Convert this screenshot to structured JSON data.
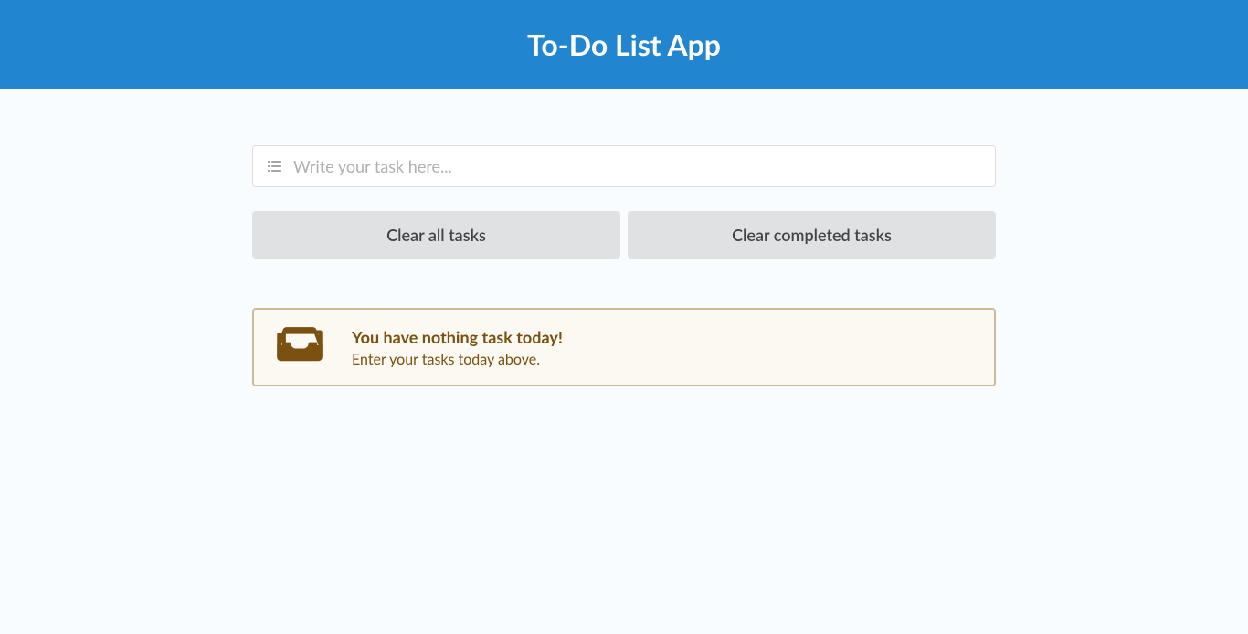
{
  "header": {
    "title": "To-Do List App"
  },
  "input": {
    "placeholder": "Write your task here...",
    "value": ""
  },
  "buttons": {
    "clear_all": "Clear all tasks",
    "clear_completed": "Clear completed tasks"
  },
  "empty_state": {
    "title": "You have nothing task today!",
    "subtitle": "Enter your tasks today above."
  }
}
